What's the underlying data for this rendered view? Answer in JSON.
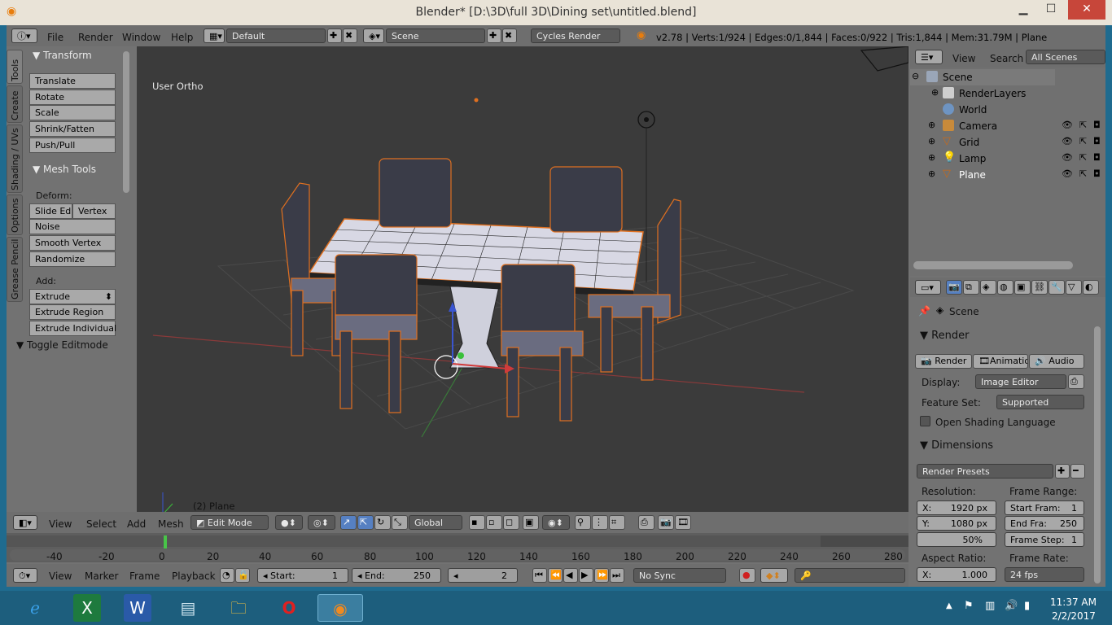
{
  "window": {
    "title": "Blender* [D:\\3D\\full 3D\\Dining set\\untitled.blend]"
  },
  "topbar": {
    "menus": [
      "File",
      "Render",
      "Window",
      "Help"
    ],
    "screen_layout": "Default",
    "scene": "Scene",
    "render_engine": "Cycles Render",
    "stats": "v2.78 | Verts:1/924 | Edges:0/1,844 | Faces:0/922 | Tris:1,844 | Mem:31.79M | Plane"
  },
  "toolshelf": {
    "tabs": [
      "Tools",
      "Create",
      "Shading / UVs",
      "Options",
      "Grease Pencil"
    ],
    "transform_title": "Transform",
    "transform": [
      "Translate",
      "Rotate",
      "Scale",
      "Shrink/Fatten",
      "Push/Pull"
    ],
    "meshtools_title": "Mesh Tools",
    "deform_label": "Deform:",
    "slide_edge": "Slide Ed",
    "vertex": "Vertex",
    "deform": [
      "Noise",
      "Smooth Vertex",
      "Randomize"
    ],
    "add_label": "Add:",
    "extrude": "Extrude",
    "add": [
      "Extrude Region",
      "Extrude Individual"
    ],
    "toggle_editmode": "Toggle Editmode"
  },
  "viewport": {
    "view_name": "User Ortho",
    "object_label": "(2) Plane"
  },
  "viewport_header": {
    "menus": [
      "View",
      "Select",
      "Add",
      "Mesh"
    ],
    "mode": "Edit Mode",
    "orientation": "Global"
  },
  "outliner": {
    "menus": [
      "View",
      "Search"
    ],
    "filter": "All Scenes",
    "items": [
      {
        "label": "Scene",
        "depth": 0
      },
      {
        "label": "RenderLayers",
        "depth": 1
      },
      {
        "label": "World",
        "depth": 1
      },
      {
        "label": "Camera",
        "depth": 1
      },
      {
        "label": "Grid",
        "depth": 1
      },
      {
        "label": "Lamp",
        "depth": 1
      },
      {
        "label": "Plane",
        "depth": 1
      }
    ]
  },
  "properties": {
    "context": "Scene",
    "render_title": "Render",
    "render_buttons": [
      "Render",
      "Animation",
      "Audio"
    ],
    "display_label": "Display:",
    "display_value": "Image Editor",
    "featureset_label": "Feature Set:",
    "featureset_value": "Supported",
    "osl_label": "Open Shading Language",
    "dimensions_title": "Dimensions",
    "presets": "Render Presets",
    "resolution_label": "Resolution:",
    "res_x": "X:",
    "res_x_val": "1920 px",
    "res_y": "Y:",
    "res_y_val": "1080 px",
    "res_pct": "50%",
    "framerange_label": "Frame Range:",
    "start_frame": "Start Fram:",
    "start_frame_val": "1",
    "end_frame": "End Fra:",
    "end_frame_val": "250",
    "frame_step": "Frame Step:",
    "frame_step_val": "1",
    "aspect_label": "Aspect Ratio:",
    "aspect_x": "X:",
    "aspect_x_val": "1.000",
    "framerate_label": "Frame Rate:",
    "framerate_val": "24 fps"
  },
  "timeline": {
    "ticks": [
      "-40",
      "-20",
      "0",
      "20",
      "40",
      "60",
      "80",
      "100",
      "120",
      "140",
      "160",
      "180",
      "200",
      "220",
      "240",
      "260",
      "280"
    ]
  },
  "timeline_header": {
    "menus": [
      "View",
      "Marker",
      "Frame",
      "Playback"
    ],
    "start_label": "Start:",
    "start_val": "1",
    "end_label": "End:",
    "end_val": "250",
    "current": "2",
    "sync": "No Sync"
  },
  "taskbar": {
    "time": "11:37 AM",
    "date": "2/2/2017"
  },
  "colors": {
    "selected_outline": "#ff8a2a",
    "accent_blue": "#5680c2"
  }
}
